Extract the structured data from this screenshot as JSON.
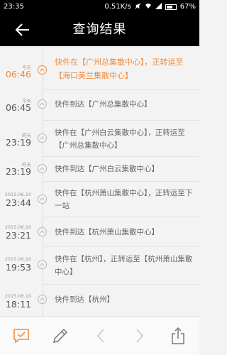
{
  "status_bar": {
    "time": "23:35",
    "net_speed": "0.51K/s",
    "battery": "67%"
  },
  "header": {
    "title": "查询结果",
    "back_icon": "back-arrow-icon"
  },
  "events": [
    {
      "date": "今天",
      "time": "06:46",
      "desc": "快件在【广州总集散中心】，正转运至【海口美兰集散中心】",
      "active": true
    },
    {
      "date": "今天",
      "time": "06:45",
      "desc": "快件到达【广州总集散中心】"
    },
    {
      "date": "昨天",
      "time": "23:19",
      "desc": "快件在【广州白云集散中心】，正转运至【广州总集散中心】"
    },
    {
      "date": "昨天",
      "time": "23:19",
      "desc": "快件到达【广州白云集散中心】"
    },
    {
      "date": "2015.06.10",
      "time": "23:44",
      "desc": "快件在【杭州萧山集散中心】，正转运至下一站"
    },
    {
      "date": "2015.06.10",
      "time": "23:21",
      "desc": "快件到达【杭州萧山集散中心】"
    },
    {
      "date": "2015.06.10",
      "time": "19:53",
      "desc": "快件在【杭州】，正转运至【杭州萧山集散中心】"
    },
    {
      "date": "2015.06.10",
      "time": "18:11",
      "desc": "快件到达【杭州】"
    }
  ],
  "toolbar": {
    "items": [
      "check-comment-icon",
      "pencil-icon",
      "chevron-left-icon",
      "chevron-right-icon",
      "share-icon"
    ]
  },
  "colors": {
    "accent": "#f08b3a",
    "header_bg": "#000000",
    "text": "#666666"
  }
}
